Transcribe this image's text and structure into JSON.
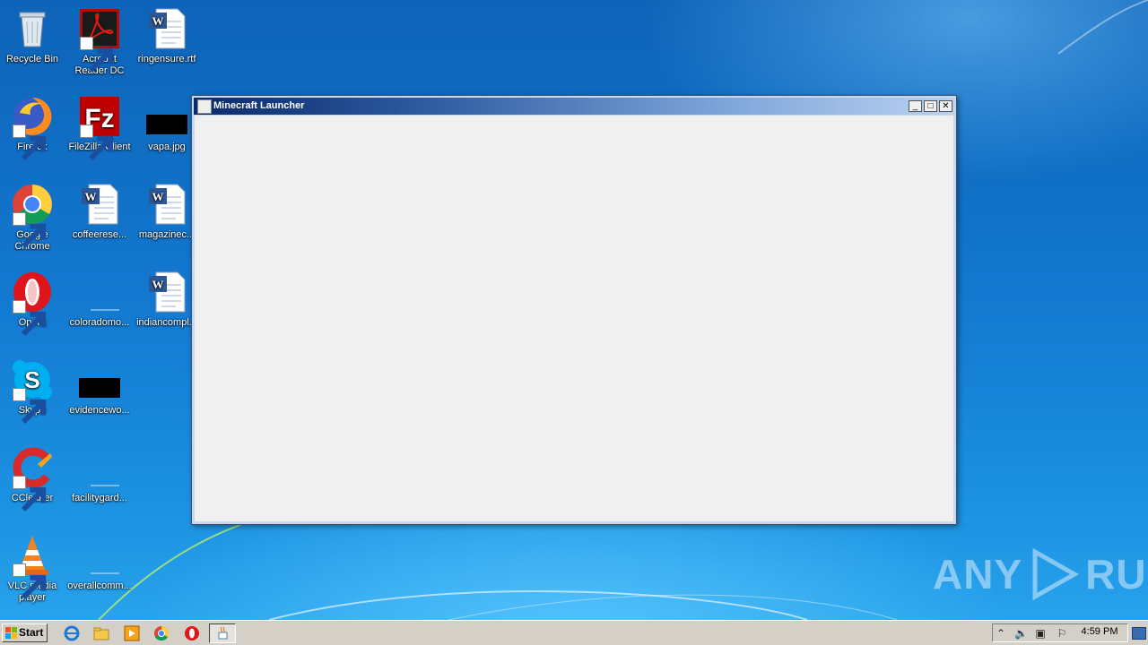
{
  "desktop": {
    "icons": [
      {
        "label": "Recycle Bin"
      },
      {
        "label": "Acrobat Reader DC"
      },
      {
        "label": "ringensure.rtf"
      },
      {
        "label": "Firefox"
      },
      {
        "label": "FileZilla Client"
      },
      {
        "label": "vapa.jpg"
      },
      {
        "label": "Google Chrome"
      },
      {
        "label": "coffeerese..."
      },
      {
        "label": "magazinec..."
      },
      {
        "label": "Opera"
      },
      {
        "label": "coloradomo..."
      },
      {
        "label": "indiancompl..."
      },
      {
        "label": "Skype"
      },
      {
        "label": "evidencewo..."
      },
      {
        "label": "CCleaner"
      },
      {
        "label": "facilitygard..."
      },
      {
        "label": "VLC media player"
      },
      {
        "label": "overallcomm..."
      }
    ]
  },
  "window": {
    "title": "Minecraft Launcher",
    "minimize_label": "_",
    "maximize_label": "□",
    "close_label": "✕"
  },
  "watermark": {
    "left": "ANY",
    "right": "RUN"
  },
  "taskbar": {
    "start_label": "Start",
    "clock": "4:59 PM"
  }
}
